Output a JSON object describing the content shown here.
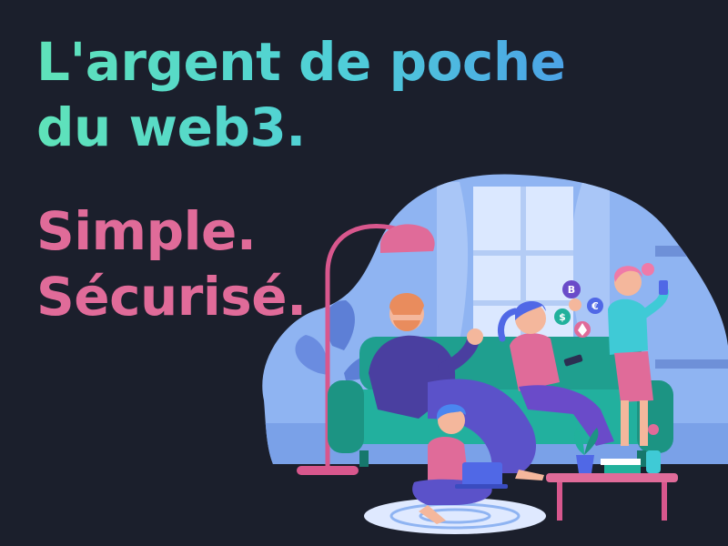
{
  "headline": {
    "line1": "L'argent de poche",
    "line2": "du web3."
  },
  "tagline": {
    "line1": "Simple.",
    "line2": "Sécurisé."
  },
  "colors": {
    "background": "#1b1f2c",
    "gradient_start": "#5fe3b9",
    "gradient_end": "#4a86f0",
    "tagline": "#e06b99",
    "sofa": "#1f9f8f",
    "room": "#8fb4f2"
  },
  "illustration": {
    "icons": [
      "bitcoin-coin-icon",
      "dollar-coin-icon",
      "euro-coin-icon",
      "ethereum-coin-icon"
    ],
    "coin_glyphs": {
      "bitcoin": "B",
      "dollar": "$",
      "euro": "€"
    }
  }
}
